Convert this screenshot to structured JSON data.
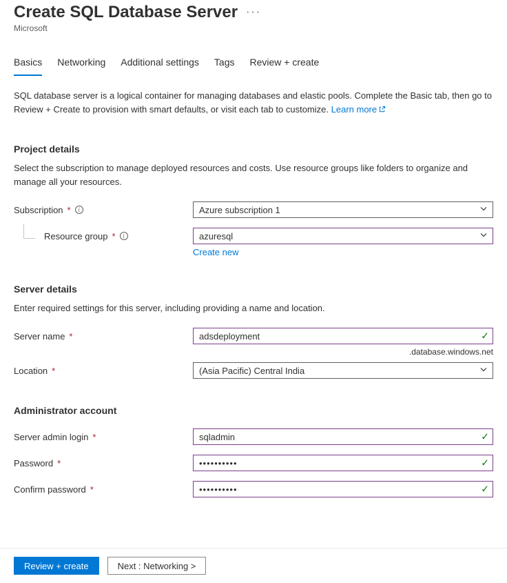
{
  "header": {
    "title": "Create SQL Database Server",
    "subtitle": "Microsoft"
  },
  "tabs": {
    "basics": "Basics",
    "networking": "Networking",
    "additional": "Additional settings",
    "tags": "Tags",
    "review": "Review + create"
  },
  "intro": {
    "text": "SQL database server is a logical container for managing databases and elastic pools. Complete the Basic tab, then go to Review + Create to provision with smart defaults, or visit each tab to customize.",
    "learn_more": "Learn more"
  },
  "project": {
    "heading": "Project details",
    "sub": "Select the subscription to manage deployed resources and costs. Use resource groups like folders to organize and manage all your resources.",
    "subscription_label": "Subscription",
    "subscription_value": "Azure subscription 1",
    "rg_label": "Resource group",
    "rg_value": "azuresql",
    "create_new": "Create new"
  },
  "server": {
    "heading": "Server details",
    "sub": "Enter required settings for this server, including providing a name and location.",
    "name_label": "Server name",
    "name_value": "adsdeployment",
    "suffix": ".database.windows.net",
    "location_label": "Location",
    "location_value": "(Asia Pacific) Central India"
  },
  "admin": {
    "heading": "Administrator account",
    "login_label": "Server admin login",
    "login_value": "sqladmin",
    "password_label": "Password",
    "password_value": "••••••••••",
    "confirm_label": "Confirm password",
    "confirm_value": "••••••••••"
  },
  "footer": {
    "review": "Review + create",
    "next": "Next : Networking >"
  }
}
